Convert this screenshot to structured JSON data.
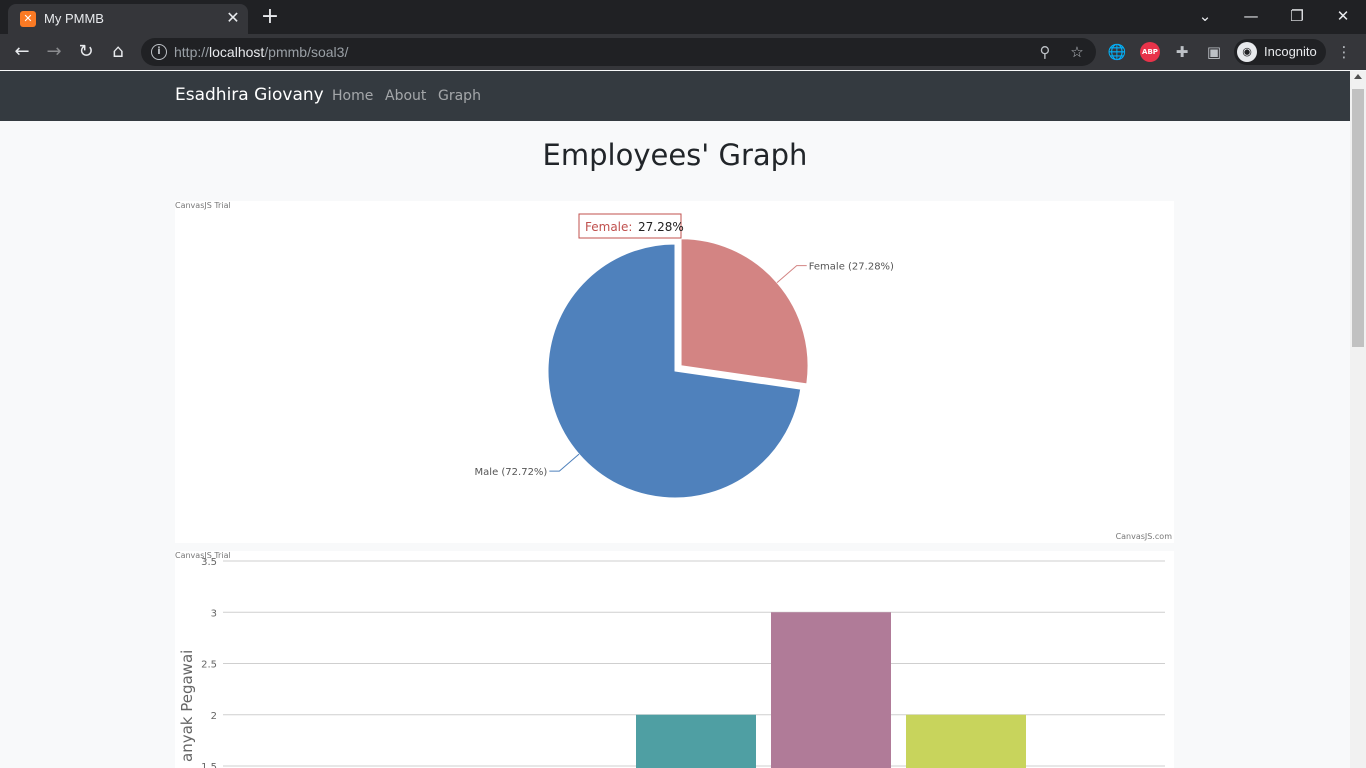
{
  "browser": {
    "tab_title": "My PMMB",
    "tab_close": "✕",
    "new_tab": "+",
    "url_scheme": "http://",
    "url_host": "localhost",
    "url_path": "/pmmb/soal3/",
    "profile_label": "Incognito",
    "abp_label": "ABP",
    "icons": [
      "back-icon",
      "forward-icon",
      "reload-icon",
      "home-icon",
      "info-icon",
      "zoom-icon",
      "star-icon",
      "translate-icon",
      "adblock-icon",
      "extensions-icon",
      "side-panel-icon",
      "incognito-icon",
      "menu-icon"
    ]
  },
  "navbar": {
    "brand": "Esadhira Giovany",
    "links": [
      "Home",
      "About",
      "Graph"
    ]
  },
  "page": {
    "title": "Employees' Graph"
  },
  "pie": {
    "trial_label": "CanvasJS Trial",
    "credit": "CanvasJS.com",
    "tooltip_name": "Female:",
    "tooltip_value": "27.28%",
    "colors": {
      "male": "#4f81bc",
      "female": "#d38483"
    }
  },
  "bar": {
    "trial_label": "CanvasJS Trial",
    "colors": [
      "#4f9fa3",
      "#b07b98",
      "#c8d45c"
    ]
  },
  "chart_data": [
    {
      "type": "pie",
      "slices": [
        {
          "label": "Female",
          "value": 27.28,
          "index_label": "Female (27.28%)",
          "exploded": true
        },
        {
          "label": "Male",
          "value": 72.72,
          "index_label": "Male (72.72%)"
        }
      ]
    },
    {
      "type": "bar",
      "ylabel": "anyak Pegawai",
      "yticks": [
        "1.5",
        "2",
        "2.5",
        "3",
        "3.5"
      ],
      "ylim": [
        1.5,
        3.5
      ],
      "values": [
        2,
        3,
        2
      ],
      "grid": true
    }
  ]
}
